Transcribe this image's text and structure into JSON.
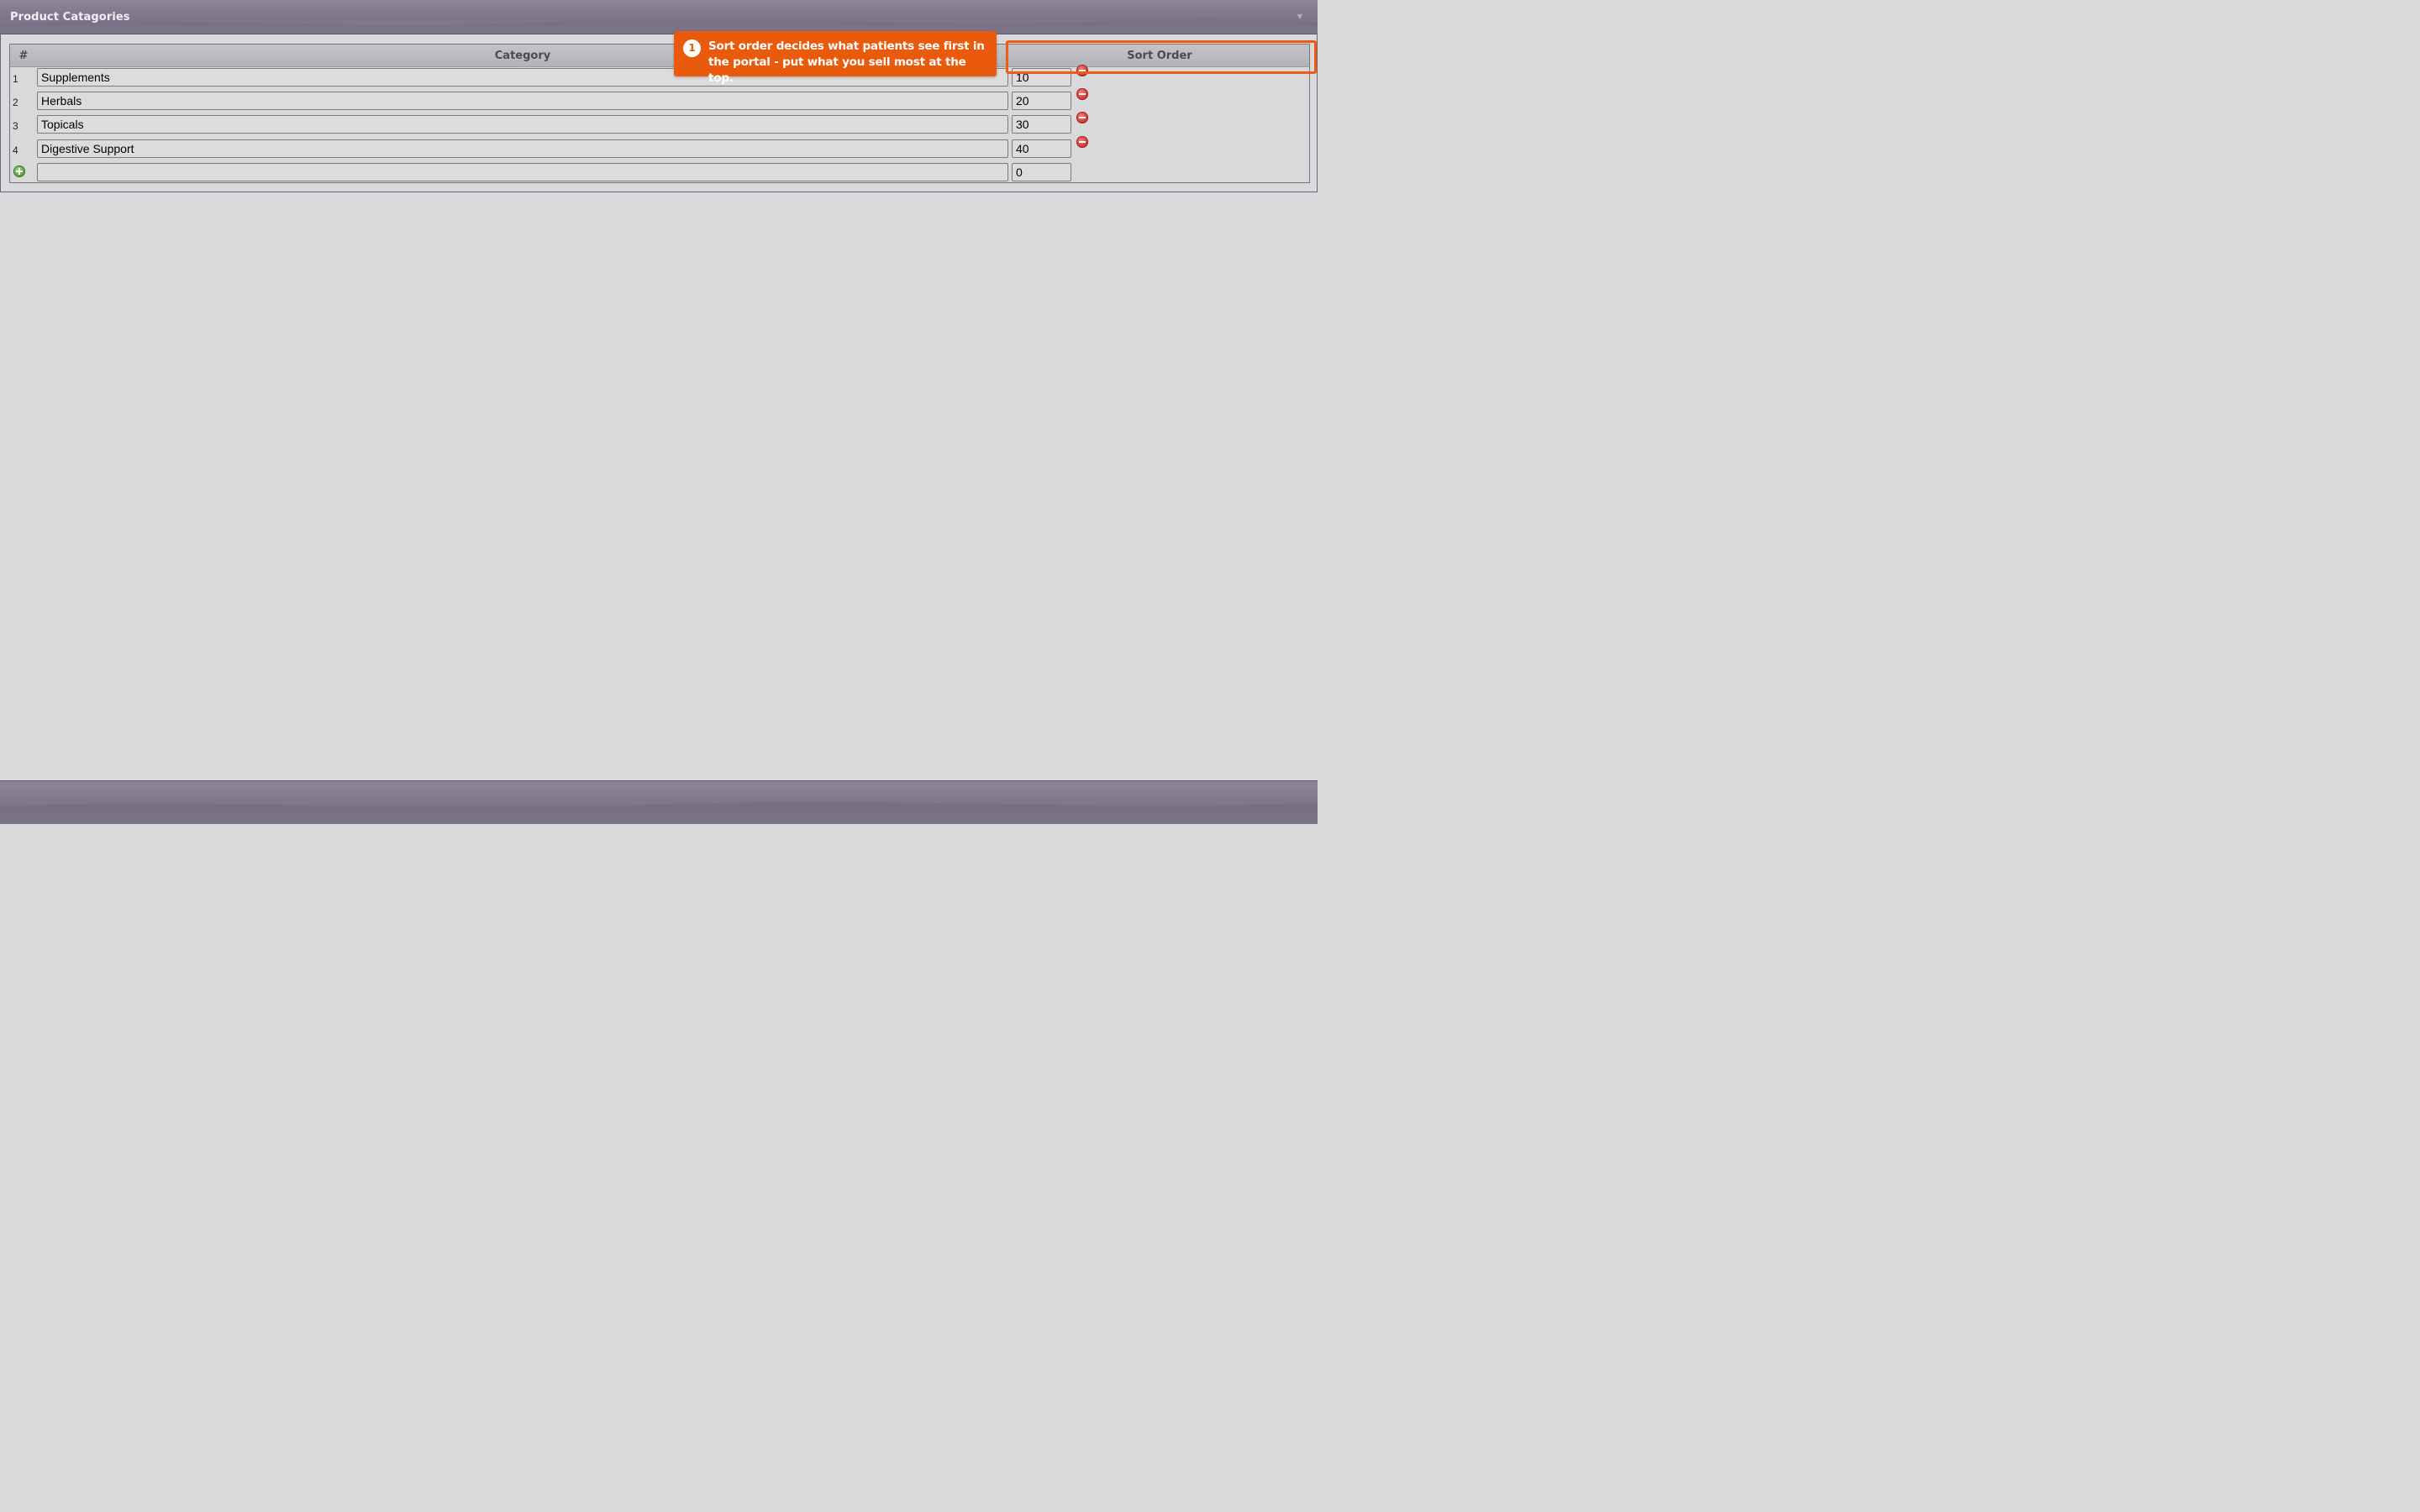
{
  "panel": {
    "title": "Product Catagories",
    "collapse_icon": "chevron-down-icon"
  },
  "grid": {
    "headers": {
      "num": "#",
      "category": "Category",
      "sort_order": "Sort Order"
    },
    "rows": [
      {
        "num": "1",
        "category": "Supplements",
        "sort_order": "10"
      },
      {
        "num": "2",
        "category": "Herbals",
        "sort_order": "20"
      },
      {
        "num": "3",
        "category": "Topicals",
        "sort_order": "30"
      },
      {
        "num": "4",
        "category": "Digestive Support",
        "sort_order": "40"
      }
    ],
    "new_row": {
      "category": "",
      "sort_order": "0"
    }
  },
  "tour": {
    "step": "1",
    "text": "Sort order decides what patients see first in the portal - put what you sell most at the top."
  },
  "colors": {
    "header_bg": "#867f92",
    "accent_orange": "#ea5a0c",
    "remove_red": "#d43a3a",
    "add_green": "#5aa142"
  }
}
